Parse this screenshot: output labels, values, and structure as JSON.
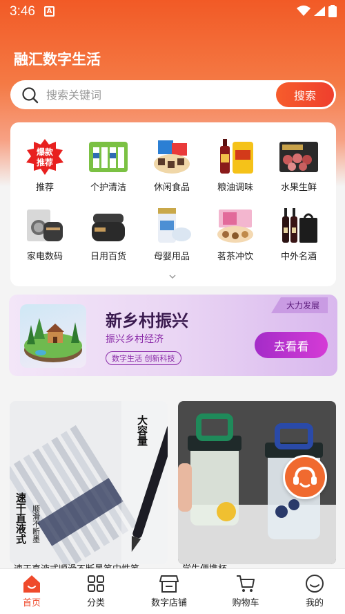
{
  "status_bar": {
    "time": "3:46",
    "notif_glyph": "A"
  },
  "app": {
    "title": "融汇数字生活"
  },
  "search": {
    "placeholder": "搜索关键词",
    "button_label": "搜索"
  },
  "categories": [
    {
      "label": "推荐",
      "icon": "hot-recommend-icon",
      "badge_line1": "爆款",
      "badge_line2": "推荐"
    },
    {
      "label": "个护清洁",
      "icon": "personal-care-icon"
    },
    {
      "label": "休闲食品",
      "icon": "snack-food-icon"
    },
    {
      "label": "粮油调味",
      "icon": "grain-oil-icon"
    },
    {
      "label": "水果生鲜",
      "icon": "fresh-fruit-icon"
    },
    {
      "label": "家电数码",
      "icon": "appliance-icon"
    },
    {
      "label": "日用百货",
      "icon": "daily-goods-icon"
    },
    {
      "label": "母婴用品",
      "icon": "baby-products-icon"
    },
    {
      "label": "茗茶冲饮",
      "icon": "tea-drinks-icon"
    },
    {
      "label": "中外名酒",
      "icon": "wine-icon"
    }
  ],
  "banner": {
    "tag": "大力发展",
    "title": "新乡村振兴",
    "subtitle": "振兴乡村经济",
    "pill": "数字生活 创新科技",
    "button_label": "去看看"
  },
  "products": [
    {
      "title": "速干直液式顺滑不断墨笔中性笔",
      "overlay_text_top": "大容量",
      "overlay_text_left": "速干直液式",
      "overlay_text_mid": "顺滑不断墨"
    },
    {
      "title": "学生便携杯"
    }
  ],
  "tabbar": [
    {
      "label": "首页",
      "icon": "home-icon",
      "active": true
    },
    {
      "label": "分类",
      "icon": "category-grid-icon"
    },
    {
      "label": "数字店铺",
      "icon": "store-icon"
    },
    {
      "label": "购物车",
      "icon": "cart-icon"
    },
    {
      "label": "我的",
      "icon": "profile-icon"
    }
  ],
  "colors": {
    "brand": "#f25a26",
    "accent": "#ef4a2b",
    "banner_purple": "#a42cc8"
  }
}
